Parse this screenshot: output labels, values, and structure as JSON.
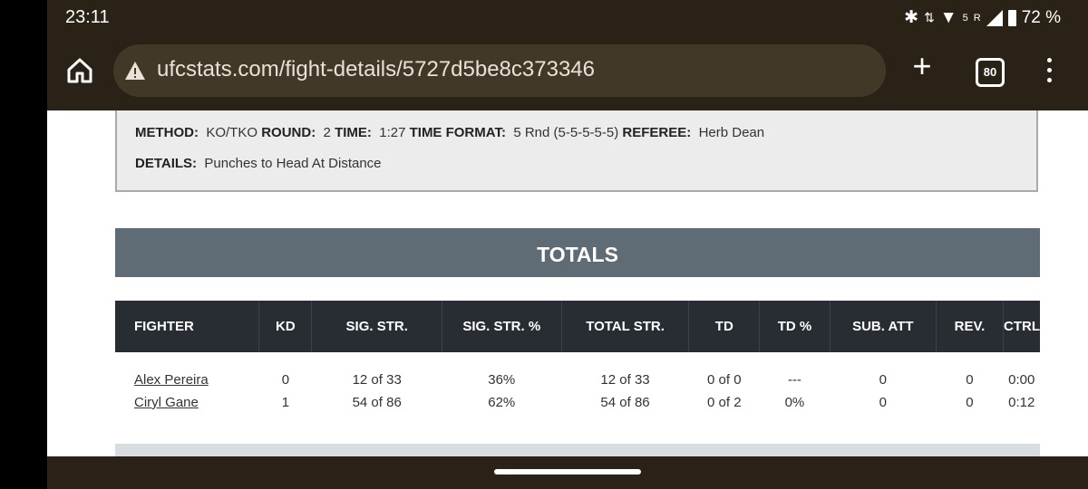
{
  "status": {
    "time": "23:11",
    "network": "5",
    "roaming": "R",
    "battery": "72 %"
  },
  "browser": {
    "url": "ufcstats.com/fight-details/5727d5be8c373346",
    "tab_count": "80"
  },
  "fight": {
    "method_label": "METHOD:",
    "method": "KO/TKO",
    "round_label": "ROUND:",
    "round": "2",
    "time_label": "TIME:",
    "time": "1:27",
    "format_label": "TIME FORMAT:",
    "format": "5 Rnd (5-5-5-5-5)",
    "referee_label": "REFEREE:",
    "referee": "Herb Dean",
    "details_label": "DETAILS:",
    "details": "Punches to Head At Distance"
  },
  "totals": {
    "title": "TOTALS",
    "headers": [
      "FIGHTER",
      "KD",
      "SIG. STR.",
      "SIG. STR. %",
      "TOTAL STR.",
      "TD",
      "TD %",
      "SUB. ATT",
      "REV.",
      "CTRL"
    ],
    "fighters": [
      "Alex Pereira",
      "Ciryl Gane"
    ],
    "kd": [
      "0",
      "1"
    ],
    "sig_str": [
      "12 of 33",
      "54 of 86"
    ],
    "sig_str_pct": [
      "36%",
      "62%"
    ],
    "total_str": [
      "12 of 33",
      "54 of 86"
    ],
    "td": [
      "0 of 0",
      "0 of 2"
    ],
    "td_pct": [
      "---",
      "0%"
    ],
    "sub_att": [
      "0",
      "0"
    ],
    "rev": [
      "0",
      "0"
    ],
    "ctrl": [
      "0:00",
      "0:12"
    ]
  },
  "colors": {
    "browser_chrome": "#2a2216",
    "totals_header": "#5f6b75",
    "table_header": "#272d33"
  }
}
